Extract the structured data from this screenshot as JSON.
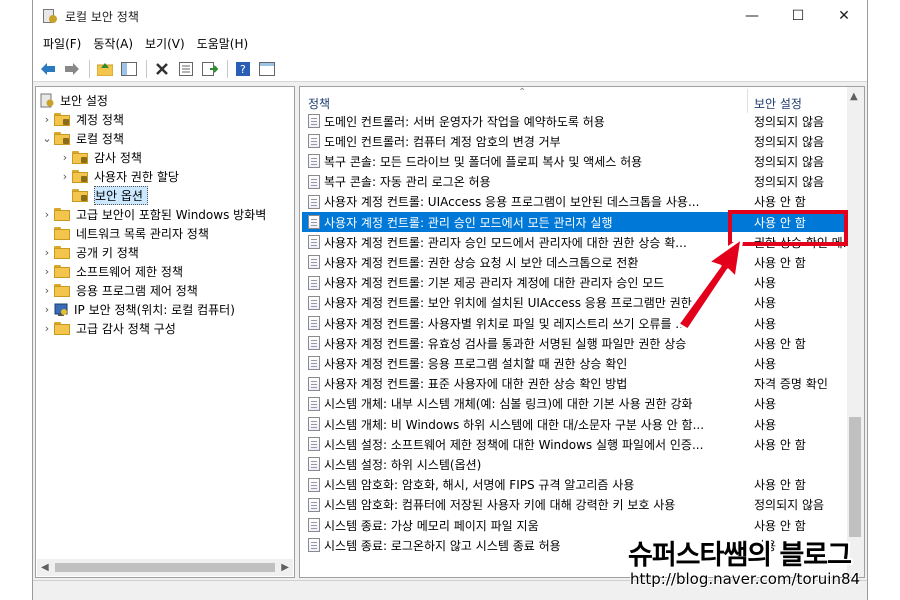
{
  "window": {
    "title": "로컬 보안 정책",
    "controls": {
      "minimize": "—",
      "maximize": "☐",
      "close": "✕"
    }
  },
  "menu": [
    "파일(F)",
    "동작(A)",
    "보기(V)",
    "도움말(H)"
  ],
  "tree": {
    "items": [
      {
        "label": "보안 설정",
        "level": 0,
        "expander": "",
        "icon": "security-settings-icon"
      },
      {
        "label": "계정 정책",
        "level": 1,
        "expander": "›",
        "icon": "folder-icon"
      },
      {
        "label": "로컬 정책",
        "level": 1,
        "expander": "⌄",
        "icon": "folder-icon"
      },
      {
        "label": "감사 정책",
        "level": 2,
        "expander": "›",
        "icon": "folder-icon"
      },
      {
        "label": "사용자 권한 할당",
        "level": 2,
        "expander": "›",
        "icon": "folder-icon"
      },
      {
        "label": "보안 옵션",
        "level": 2,
        "expander": "",
        "icon": "folder-icon",
        "selected": true
      },
      {
        "label": "고급 보안이 포함된 Windows 방화벽",
        "level": 1,
        "expander": "›",
        "icon": "folder-icon"
      },
      {
        "label": "네트워크 목록 관리자 정책",
        "level": 1,
        "expander": "",
        "icon": "folder-icon"
      },
      {
        "label": "공개 키 정책",
        "level": 1,
        "expander": "›",
        "icon": "folder-icon"
      },
      {
        "label": "소프트웨어 제한 정책",
        "level": 1,
        "expander": "›",
        "icon": "folder-icon"
      },
      {
        "label": "응용 프로그램 제어 정책",
        "level": 1,
        "expander": "›",
        "icon": "folder-icon"
      },
      {
        "label": "IP 보안 정책(위치: 로컬 컴퓨터)",
        "level": 1,
        "expander": "›",
        "icon": "ip-security-icon"
      },
      {
        "label": "고급 감사 정책 구성",
        "level": 1,
        "expander": "›",
        "icon": "folder-icon"
      }
    ]
  },
  "list": {
    "columns": {
      "policy": "정책",
      "setting": "보안 설정"
    },
    "rows": [
      {
        "policy": "도메인 컨트롤러: 서버 운영자가 작업을 예약하도록 허용",
        "setting": "정의되지 않음"
      },
      {
        "policy": "도메인 컨트롤러: 컴퓨터 계정 암호의 변경 거부",
        "setting": "정의되지 않음"
      },
      {
        "policy": "복구 콘솔: 모든 드라이브 및 폴더에 플로피 복사 및 액세스 허용",
        "setting": "정의되지 않음"
      },
      {
        "policy": "복구 콘솔: 자동 관리 로그온 허용",
        "setting": "정의되지 않음"
      },
      {
        "policy": "사용자 계정 컨트롤: UIAccess 응용 프로그램이 보안된 데스크톱을 사용...",
        "setting": "사용 안 함"
      },
      {
        "policy": "사용자 계정 컨트롤: 관리 승인 모드에서 모든 관리자 실행",
        "setting": "사용 안 함",
        "selected": true
      },
      {
        "policy": "사용자 계정 컨트롤: 관리자 승인 모드에서 관리자에 대한 권한 상승 확...",
        "setting": "권한 상승 확인 메..."
      },
      {
        "policy": "사용자 계정 컨트롤: 권한 상승 요청 시 보안 데스크톱으로 전환",
        "setting": "사용 안 함"
      },
      {
        "policy": "사용자 계정 컨트롤: 기본 제공 관리자 계정에 대한 관리자 승인 모드",
        "setting": "사용"
      },
      {
        "policy": "사용자 계정 컨트롤: 보안 위치에 설치된 UIAccess 응용 프로그램만 권한...",
        "setting": "사용"
      },
      {
        "policy": "사용자 계정 컨트롤: 사용자별 위치로 파일 및 레지스트리 쓰기 오류를 ...",
        "setting": "사용"
      },
      {
        "policy": "사용자 계정 컨트롤: 유효성 검사를 통과한 서명된 실행 파일만 권한 상승",
        "setting": "사용 안 함"
      },
      {
        "policy": "사용자 계정 컨트롤: 응용 프로그램 설치할 때 권한 상승 확인",
        "setting": "사용"
      },
      {
        "policy": "사용자 계정 컨트롤: 표준 사용자에 대한 권한 상승 확인 방법",
        "setting": "자격 증명 확인"
      },
      {
        "policy": "시스템 개체: 내부 시스템 개체(예: 심볼 링크)에 대한 기본 사용 권한 강화",
        "setting": "사용"
      },
      {
        "policy": "시스템 개체: 비 Windows 하위 시스템에 대한 대/소문자 구분 사용 안 함...",
        "setting": "사용"
      },
      {
        "policy": "시스템 설정: 소프트웨어 제한 정책에 대한 Windows 실행 파일에서 인증...",
        "setting": "사용 안 함"
      },
      {
        "policy": "시스템 설정: 하위 시스템(옵션)",
        "setting": ""
      },
      {
        "policy": "시스템 암호화: 암호화, 해시, 서명에 FIPS 규격 알고리즘 사용",
        "setting": "사용 안 함"
      },
      {
        "policy": "시스템 암호화: 컴퓨터에 저장된 사용자 키에 대해 강력한 키 보호 사용",
        "setting": "정의되지 않음"
      },
      {
        "policy": "시스템 종료: 가상 메모리 페이지 파일 지움",
        "setting": "사용 안 함"
      },
      {
        "policy": "시스템 종료: 로그온하지 않고 시스템 종료 허용",
        "setting": "사용"
      }
    ]
  },
  "watermark": {
    "title": "슈퍼스타쌤의 블로그",
    "url": "http://blog.naver.com/toruin84"
  },
  "colors": {
    "selection": "#0078d7",
    "annotation": "#e3001b"
  }
}
